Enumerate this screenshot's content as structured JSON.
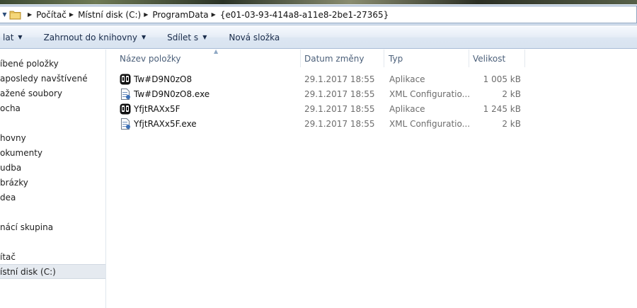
{
  "address_bar": {
    "crumbs": [
      "Počítač",
      "Místní disk (C:)",
      "ProgramData",
      "{e01-03-93-414a8-a11e8-2be1-27365}"
    ]
  },
  "command_bar": {
    "organize_label": "lat",
    "include_label": "Zahrnout do knihovny",
    "share_label": "Sdílet s",
    "new_folder_label": "Nová složka"
  },
  "sidebar": {
    "items": [
      {
        "label": "íbené položky"
      },
      {
        "label": "aposledy navštívené"
      },
      {
        "label": "ažené soubory"
      },
      {
        "label": "ocha"
      },
      {
        "label": "hovny"
      },
      {
        "label": "okumenty"
      },
      {
        "label": "udba"
      },
      {
        "label": "brázky"
      },
      {
        "label": "dea"
      },
      {
        "label": "nácí skupina"
      },
      {
        "label": "ítač"
      },
      {
        "label": "ístní disk (C:)"
      }
    ]
  },
  "columns": {
    "name": "Název položky",
    "date": "Datum změny",
    "type": "Typ",
    "size": "Velikost"
  },
  "files": [
    {
      "name": "Tw#D9N0zO8",
      "date": "29.1.2017 18:55",
      "type": "Aplikace",
      "size": "1 005 kB",
      "icon": "application-icon"
    },
    {
      "name": "Tw#D9N0zO8.exe",
      "date": "29.1.2017 18:55",
      "type": "XML Configuratio...",
      "size": "2 kB",
      "icon": "xml-config-file-icon"
    },
    {
      "name": "YfjtRAXx5F",
      "date": "29.1.2017 18:55",
      "type": "Aplikace",
      "size": "1 245 kB",
      "icon": "application-icon"
    },
    {
      "name": "YfjtRAXx5F.exe",
      "date": "29.1.2017 18:55",
      "type": "XML Configuratio...",
      "size": "2 kB",
      "icon": "xml-config-file-icon"
    }
  ],
  "colors": {
    "accent": "#1a2c4a",
    "header_text": "#4c607a",
    "meta_text": "#6d6d6d"
  }
}
